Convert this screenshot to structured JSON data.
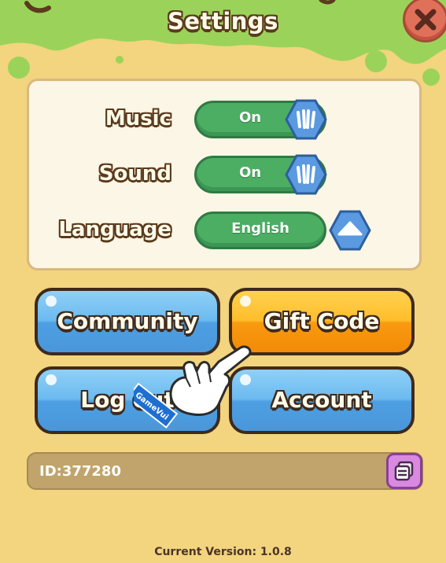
{
  "header": {
    "title": "Settings"
  },
  "settings": {
    "music": {
      "label": "Music",
      "value": "On"
    },
    "sound": {
      "label": "Sound",
      "value": "On"
    },
    "language": {
      "label": "Language",
      "value": "English"
    }
  },
  "buttons": {
    "community": "Community",
    "gift_code": "Gift Code",
    "log_out": "Log out",
    "account": "Account"
  },
  "account_id": "ID:377280",
  "footer": {
    "version": "Current Version: 1.0.8"
  },
  "overlay": {
    "watermark": "GameVui"
  },
  "colors": {
    "background": "#f3d47f",
    "header_slime": "#9bd35a",
    "toggle_green": "#4cae63",
    "knob_blue": "#5b9ae0",
    "button_blue": "#6cbaf0",
    "button_orange": "#ffbd2b",
    "close_red": "#e0705a",
    "copy_purple": "#d88ae0"
  },
  "icons": {
    "close": "close-x-icon",
    "toggle_knob": "toggle-knob-icon",
    "dropdown": "chevron-up-icon",
    "copy": "copy-icon",
    "pointer": "pointing-hand-icon"
  }
}
